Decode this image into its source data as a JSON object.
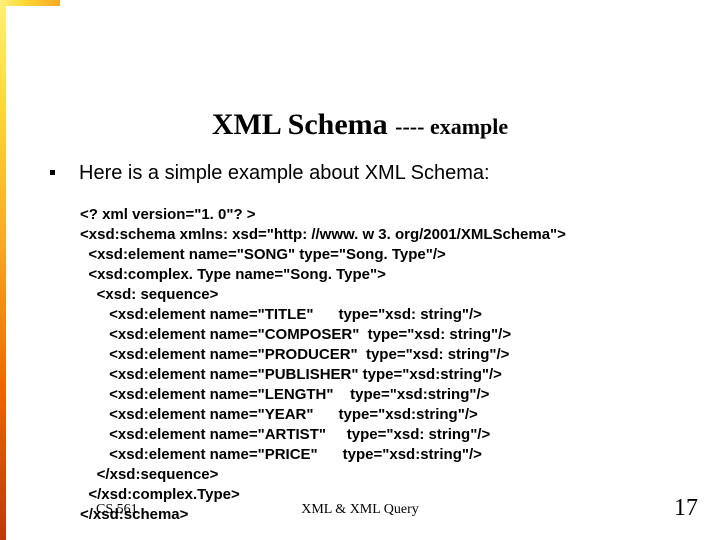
{
  "title": {
    "main": "XML Schema ",
    "sub": "---- example"
  },
  "bullet": "Here is a simple example about XML Schema:",
  "code": "<? xml version=\"1. 0\"? >\n<xsd:schema xmlns: xsd=\"http: //www. w 3. org/2001/XMLSchema\">\n  <xsd:element name=\"SONG\" type=\"Song. Type\"/>\n  <xsd:complex. Type name=\"Song. Type\">\n    <xsd: sequence>\n       <xsd:element name=\"TITLE\"      type=\"xsd: string\"/>\n       <xsd:element name=\"COMPOSER\"  type=\"xsd: string\"/>\n       <xsd:element name=\"PRODUCER\"  type=\"xsd: string\"/>\n       <xsd:element name=\"PUBLISHER\" type=\"xsd:string\"/>\n       <xsd:element name=\"LENGTH\"    type=\"xsd:string\"/>\n       <xsd:element name=\"YEAR\"      type=\"xsd:string\"/>\n       <xsd:element name=\"ARTIST\"     type=\"xsd: string\"/>\n       <xsd:element name=\"PRICE\"      type=\"xsd:string\"/>\n    </xsd:sequence>\n  </xsd:complex.Type>\n</xsd:schema>",
  "footer": {
    "left": "CS 561",
    "center": "XML & XML Query",
    "right": "17"
  }
}
